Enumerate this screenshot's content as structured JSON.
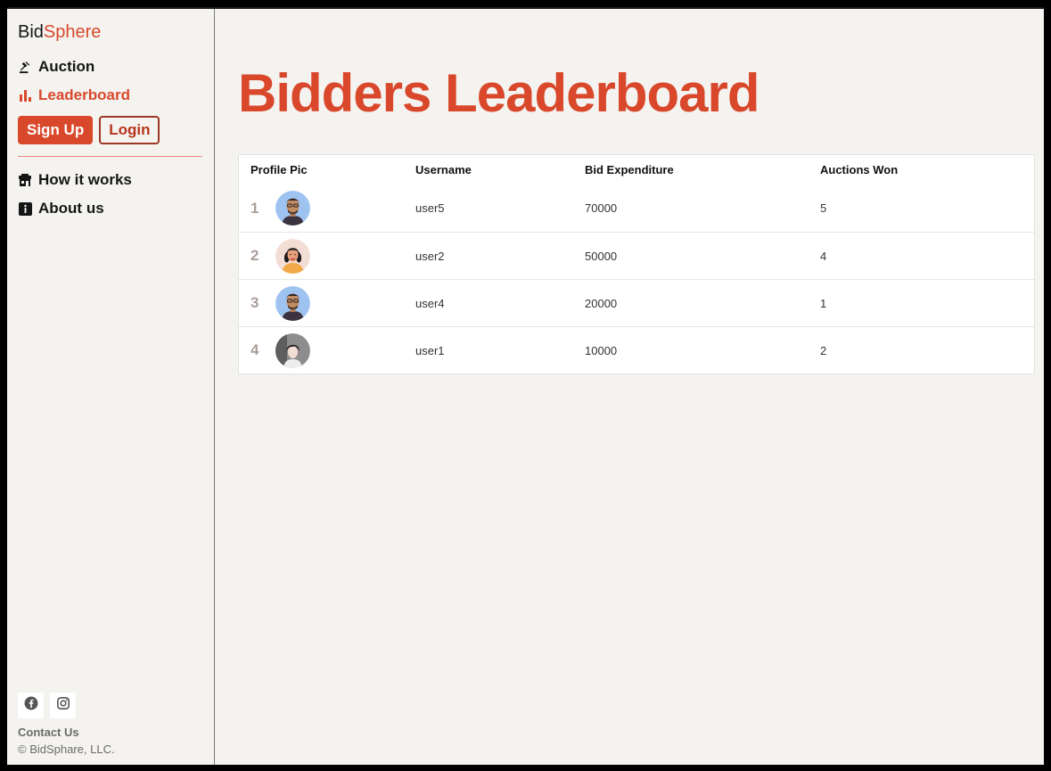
{
  "brand": {
    "part1": "Bid",
    "part2": "Sphere"
  },
  "nav": {
    "auction": "Auction",
    "leaderboard": "Leaderboard",
    "how_it_works": "How it works",
    "about_us": "About us"
  },
  "auth": {
    "signup": "Sign Up",
    "login": "Login"
  },
  "footer": {
    "contact": "Contact Us",
    "copyright": "© BidSphare, LLC."
  },
  "page": {
    "title": "Bidders Leaderboard"
  },
  "table": {
    "headers": [
      "Profile Pic",
      "Username",
      "Bid Expenditure",
      "Auctions Won"
    ],
    "rows": [
      {
        "rank": "1",
        "avatar": "man-glasses-avatar",
        "username": "user5",
        "bid_expenditure": "70000",
        "auctions_won": "5"
      },
      {
        "rank": "2",
        "avatar": "woman-avatar",
        "username": "user2",
        "bid_expenditure": "50000",
        "auctions_won": "4"
      },
      {
        "rank": "3",
        "avatar": "man-glasses-avatar",
        "username": "user4",
        "bid_expenditure": "20000",
        "auctions_won": "1"
      },
      {
        "rank": "4",
        "avatar": "photo-avatar",
        "username": "user1",
        "bid_expenditure": "10000",
        "auctions_won": "2"
      }
    ]
  },
  "colors": {
    "accent": "#d9482b",
    "background": "#f4f3f0"
  }
}
